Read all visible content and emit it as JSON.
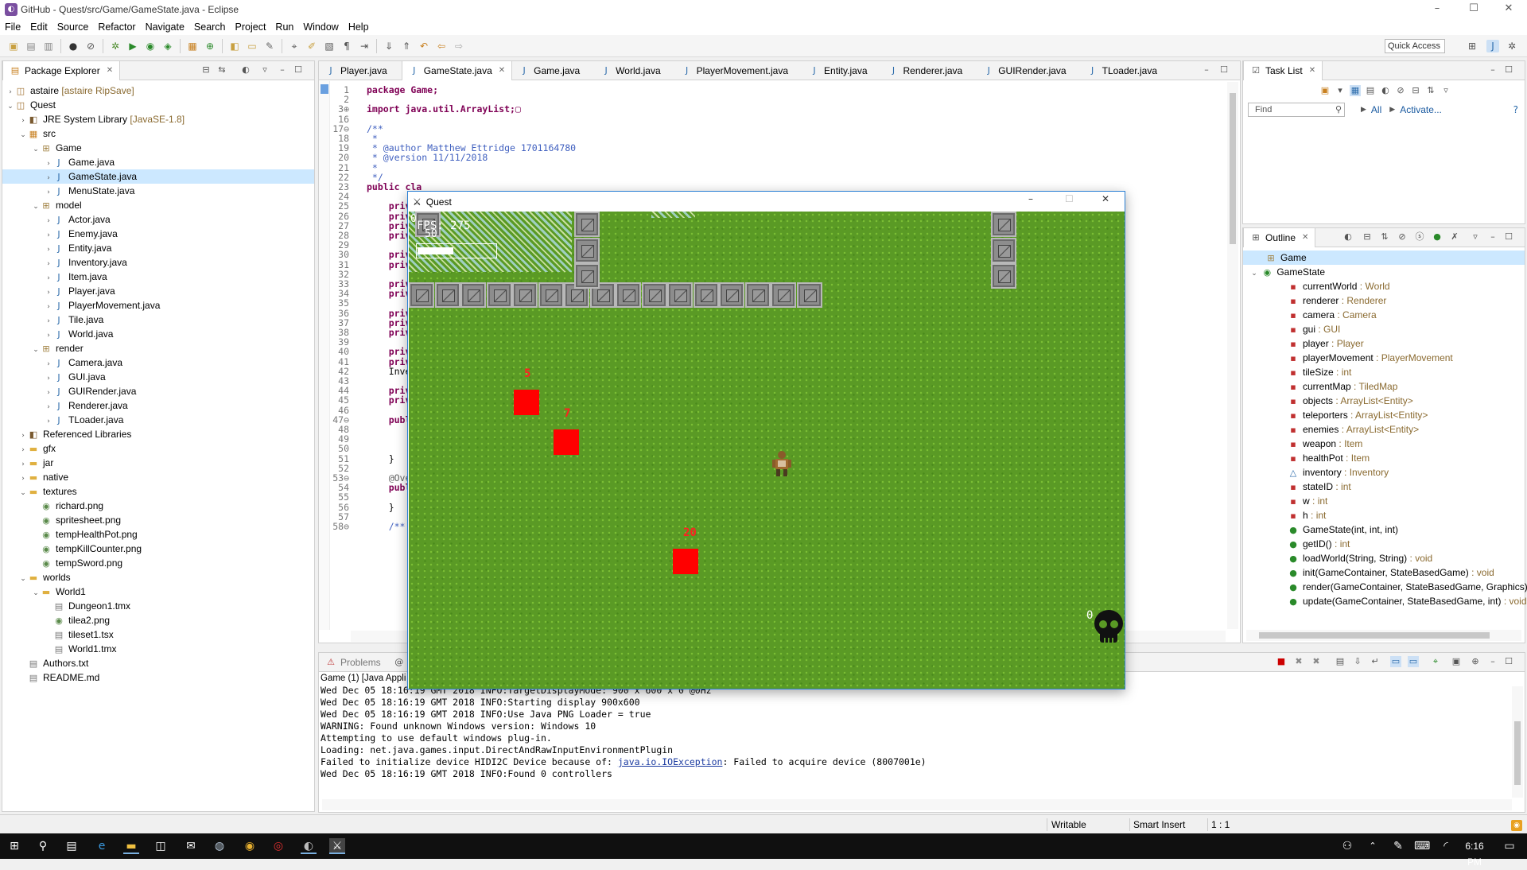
{
  "window": {
    "title": "GitHub - Quest/src/Game/GameState.java - Eclipse",
    "minimize": "–",
    "maximize": "☐",
    "close": "✕"
  },
  "menu": [
    "File",
    "Edit",
    "Source",
    "Refactor",
    "Navigate",
    "Search",
    "Project",
    "Run",
    "Window",
    "Help"
  ],
  "toolbar": {
    "quick_access": "Quick Access"
  },
  "package_explorer": {
    "tab_label": "Package Explorer",
    "tree": [
      {
        "level": 0,
        "arrow": "›",
        "icon": "project",
        "label": "astaire",
        "extra": " [astaire RipSave]"
      },
      {
        "level": 0,
        "arrow": "⌄",
        "icon": "project",
        "label": "Quest",
        "extra": ""
      },
      {
        "level": 1,
        "arrow": "›",
        "icon": "library",
        "label": "JRE System Library",
        "extra": " [JavaSE-1.8]"
      },
      {
        "level": 1,
        "arrow": "⌄",
        "icon": "srcfolder",
        "label": "src",
        "extra": ""
      },
      {
        "level": 2,
        "arrow": "⌄",
        "icon": "package",
        "label": "Game",
        "extra": ""
      },
      {
        "level": 3,
        "arrow": "›",
        "icon": "java",
        "label": "Game.java",
        "extra": ""
      },
      {
        "level": 3,
        "arrow": "›",
        "icon": "java",
        "label": "GameState.java",
        "extra": "",
        "selected": true
      },
      {
        "level": 3,
        "arrow": "›",
        "icon": "java",
        "label": "MenuState.java",
        "extra": ""
      },
      {
        "level": 2,
        "arrow": "⌄",
        "icon": "package",
        "label": "model",
        "extra": ""
      },
      {
        "level": 3,
        "arrow": "›",
        "icon": "java",
        "label": "Actor.java",
        "extra": ""
      },
      {
        "level": 3,
        "arrow": "›",
        "icon": "java",
        "label": "Enemy.java",
        "extra": ""
      },
      {
        "level": 3,
        "arrow": "›",
        "icon": "java",
        "label": "Entity.java",
        "extra": ""
      },
      {
        "level": 3,
        "arrow": "›",
        "icon": "java",
        "label": "Inventory.java",
        "extra": ""
      },
      {
        "level": 3,
        "arrow": "›",
        "icon": "java",
        "label": "Item.java",
        "extra": ""
      },
      {
        "level": 3,
        "arrow": "›",
        "icon": "java",
        "label": "Player.java",
        "extra": ""
      },
      {
        "level": 3,
        "arrow": "›",
        "icon": "java",
        "label": "PlayerMovement.java",
        "extra": ""
      },
      {
        "level": 3,
        "arrow": "›",
        "icon": "java",
        "label": "Tile.java",
        "extra": ""
      },
      {
        "level": 3,
        "arrow": "›",
        "icon": "java",
        "label": "World.java",
        "extra": ""
      },
      {
        "level": 2,
        "arrow": "⌄",
        "icon": "package",
        "label": "render",
        "extra": ""
      },
      {
        "level": 3,
        "arrow": "›",
        "icon": "java",
        "label": "Camera.java",
        "extra": ""
      },
      {
        "level": 3,
        "arrow": "›",
        "icon": "java",
        "label": "GUI.java",
        "extra": ""
      },
      {
        "level": 3,
        "arrow": "›",
        "icon": "java",
        "label": "GUIRender.java",
        "extra": ""
      },
      {
        "level": 3,
        "arrow": "›",
        "icon": "java",
        "label": "Renderer.java",
        "extra": ""
      },
      {
        "level": 3,
        "arrow": "›",
        "icon": "java",
        "label": "TLoader.java",
        "extra": ""
      },
      {
        "level": 1,
        "arrow": "›",
        "icon": "library",
        "label": "Referenced Libraries",
        "extra": ""
      },
      {
        "level": 1,
        "arrow": "›",
        "icon": "folder",
        "label": "gfx",
        "extra": ""
      },
      {
        "level": 1,
        "arrow": "›",
        "icon": "folder",
        "label": "jar",
        "extra": ""
      },
      {
        "level": 1,
        "arrow": "›",
        "icon": "folder",
        "label": "native",
        "extra": ""
      },
      {
        "level": 1,
        "arrow": "⌄",
        "icon": "folder",
        "label": "textures",
        "extra": ""
      },
      {
        "level": 2,
        "arrow": "",
        "icon": "image",
        "label": "richard.png",
        "extra": ""
      },
      {
        "level": 2,
        "arrow": "",
        "icon": "image",
        "label": "spritesheet.png",
        "extra": ""
      },
      {
        "level": 2,
        "arrow": "",
        "icon": "image",
        "label": "tempHealthPot.png",
        "extra": ""
      },
      {
        "level": 2,
        "arrow": "",
        "icon": "image",
        "label": "tempKillCounter.png",
        "extra": ""
      },
      {
        "level": 2,
        "arrow": "",
        "icon": "image",
        "label": "tempSword.png",
        "extra": ""
      },
      {
        "level": 1,
        "arrow": "⌄",
        "icon": "folder",
        "label": "worlds",
        "extra": ""
      },
      {
        "level": 2,
        "arrow": "⌄",
        "icon": "folder",
        "label": "World1",
        "extra": ""
      },
      {
        "level": 3,
        "arrow": "",
        "icon": "file",
        "label": "Dungeon1.tmx",
        "extra": ""
      },
      {
        "level": 3,
        "arrow": "",
        "icon": "image",
        "label": "tilea2.png",
        "extra": ""
      },
      {
        "level": 3,
        "arrow": "",
        "icon": "file",
        "label": "tileset1.tsx",
        "extra": ""
      },
      {
        "level": 3,
        "arrow": "",
        "icon": "file",
        "label": "World1.tmx",
        "extra": ""
      },
      {
        "level": 1,
        "arrow": "",
        "icon": "file",
        "label": "Authors.txt",
        "extra": ""
      },
      {
        "level": 1,
        "arrow": "",
        "icon": "file",
        "label": "README.md",
        "extra": ""
      }
    ]
  },
  "editor": {
    "tabs": [
      "Player.java",
      "GameState.java",
      "Game.java",
      "World.java",
      "PlayerMovement.java",
      "Entity.java",
      "Renderer.java",
      "GUIRender.java",
      "TLoader.java"
    ],
    "active_tab": 1,
    "lines": [
      {
        "n": "1",
        "t": "package Game;",
        "c": "kwline"
      },
      {
        "n": "2",
        "t": "",
        "c": ""
      },
      {
        "n": "3⊕",
        "t": "import java.util.ArrayList;▢",
        "c": "kwline"
      },
      {
        "n": "16",
        "t": "",
        "c": ""
      },
      {
        "n": "17⊖",
        "t": "/**",
        "c": "jd"
      },
      {
        "n": "18",
        "t": " *",
        "c": "jd"
      },
      {
        "n": "19",
        "t": " * @author Matthew Ettridge 1701164780",
        "c": "jd"
      },
      {
        "n": "20",
        "t": " * @version 11/11/2018",
        "c": "jd"
      },
      {
        "n": "21",
        "t": " *",
        "c": "jd"
      },
      {
        "n": "22",
        "t": " */",
        "c": "jd"
      },
      {
        "n": "23",
        "t": "public cla",
        "c": "kwline"
      },
      {
        "n": "24",
        "t": "",
        "c": ""
      },
      {
        "n": "25",
        "t": "    priva",
        "c": "kwline"
      },
      {
        "n": "26",
        "t": "    priva",
        "c": "kwline"
      },
      {
        "n": "27",
        "t": "    priva",
        "c": "kwline"
      },
      {
        "n": "28",
        "t": "    priva",
        "c": "kwline"
      },
      {
        "n": "29",
        "t": "",
        "c": ""
      },
      {
        "n": "30",
        "t": "    priva",
        "c": "kwline"
      },
      {
        "n": "31",
        "t": "    priva",
        "c": "kwline"
      },
      {
        "n": "32",
        "t": "",
        "c": ""
      },
      {
        "n": "33",
        "t": "    priva",
        "c": "kwline"
      },
      {
        "n": "34",
        "t": "    priva",
        "c": "kwline"
      },
      {
        "n": "35",
        "t": "",
        "c": ""
      },
      {
        "n": "36",
        "t": "    priva",
        "c": "kwline"
      },
      {
        "n": "37",
        "t": "    priva",
        "c": "kwline"
      },
      {
        "n": "38",
        "t": "    priva",
        "c": "kwline"
      },
      {
        "n": "39",
        "t": "",
        "c": ""
      },
      {
        "n": "40",
        "t": "    priva",
        "c": "kwline"
      },
      {
        "n": "41",
        "t": "    priva",
        "c": "kwline"
      },
      {
        "n": "42",
        "t": "    Invent",
        "c": ""
      },
      {
        "n": "43",
        "t": "",
        "c": ""
      },
      {
        "n": "44",
        "t": "    priva",
        "c": "kwline"
      },
      {
        "n": "45",
        "t": "    priva",
        "c": "kwline"
      },
      {
        "n": "46",
        "t": "",
        "c": ""
      },
      {
        "n": "47⊖",
        "t": "    publi",
        "c": "kwline"
      },
      {
        "n": "48",
        "t": "        th",
        "c": "kwline"
      },
      {
        "n": "49",
        "t": "        th",
        "c": "kwline"
      },
      {
        "n": "50",
        "t": "        th",
        "c": "kwline"
      },
      {
        "n": "51",
        "t": "    }",
        "c": ""
      },
      {
        "n": "52",
        "t": "",
        "c": ""
      },
      {
        "n": "53⊖",
        "t": "    @Overr",
        "c": "ann"
      },
      {
        "n": "54",
        "t": "    publi",
        "c": "kwline"
      },
      {
        "n": "55",
        "t": "        re",
        "c": "kwline"
      },
      {
        "n": "56",
        "t": "    }",
        "c": ""
      },
      {
        "n": "57",
        "t": "",
        "c": ""
      },
      {
        "n": "58⊖",
        "t": "    /**",
        "c": "jd"
      }
    ]
  },
  "task_list": {
    "tab_label": "Task List",
    "find_placeholder": "Find",
    "all_label": "All",
    "activate_label": "Activate..."
  },
  "outline": {
    "tab_label": "Outline",
    "package": "Game",
    "class": "GameState",
    "members": [
      {
        "name": "currentWorld",
        "type": "World",
        "kind": "field"
      },
      {
        "name": "renderer",
        "type": "Renderer",
        "kind": "field"
      },
      {
        "name": "camera",
        "type": "Camera",
        "kind": "field"
      },
      {
        "name": "gui",
        "type": "GUI",
        "kind": "field"
      },
      {
        "name": "player",
        "type": "Player",
        "kind": "field"
      },
      {
        "name": "playerMovement",
        "type": "PlayerMovement",
        "kind": "field"
      },
      {
        "name": "tileSize",
        "type": "int",
        "kind": "field"
      },
      {
        "name": "currentMap",
        "type": "TiledMap",
        "kind": "field"
      },
      {
        "name": "objects",
        "type": "ArrayList<Entity>",
        "kind": "field"
      },
      {
        "name": "teleporters",
        "type": "ArrayList<Entity>",
        "kind": "field"
      },
      {
        "name": "enemies",
        "type": "ArrayList<Entity>",
        "kind": "field"
      },
      {
        "name": "weapon",
        "type": "Item",
        "kind": "field"
      },
      {
        "name": "healthPot",
        "type": "Item",
        "kind": "field"
      },
      {
        "name": "inventory",
        "type": "Inventory",
        "kind": "pkgfield"
      },
      {
        "name": "stateID",
        "type": "int",
        "kind": "field"
      },
      {
        "name": "w",
        "type": "int",
        "kind": "field"
      },
      {
        "name": "h",
        "type": "int",
        "kind": "field"
      },
      {
        "name": "GameState(int, int, int)",
        "type": "",
        "kind": "ctor"
      },
      {
        "name": "getID()",
        "type": "int",
        "kind": "method"
      },
      {
        "name": "loadWorld(String, String)",
        "type": "void",
        "kind": "method"
      },
      {
        "name": "init(GameContainer, StateBasedGame)",
        "type": "void",
        "kind": "method"
      },
      {
        "name": "render(GameContainer, StateBasedGame, Graphics)",
        "type": "void",
        "kind": "method"
      },
      {
        "name": "update(GameContainer, StateBasedGame, int)",
        "type": "void",
        "kind": "method"
      }
    ]
  },
  "console": {
    "tab_problems": "Problems",
    "tab_partial": "Ja",
    "header": "Game (1) [Java Appli",
    "lines": [
      "Wed Dec 05 18:16:19 GMT 2018 INFO:TargetDisplayMode: 900 x 600 x 0 @0Hz",
      "Wed Dec 05 18:16:19 GMT 2018 INFO:Starting display 900x600",
      "Wed Dec 05 18:16:19 GMT 2018 INFO:Use Java PNG Loader = true",
      "WARNING: Found unknown Windows version: Windows 10",
      "Attempting to use default windows plug-in.",
      "Loading: net.java.games.input.DirectAndRawInputEnvironmentPlugin"
    ],
    "error_prefix": "Failed to initialize device HIDI2C Device because of: ",
    "error_link": "java.io.IOException",
    "error_suffix": ": Failed to acquire device (8007001e)",
    "last_line": "Wed Dec 05 18:16:19 GMT 2018 INFO:Found 0 controllers"
  },
  "status": {
    "writable": "Writable",
    "insert": "Smart Insert",
    "position": "1 : 1"
  },
  "game": {
    "title": "Quest",
    "fps": "FPS: 275",
    "health": "50",
    "health_fraction": 0.45,
    "corner_zero": "0",
    "kill_count": "0",
    "enemies": [
      {
        "label": "5"
      },
      {
        "label": "7"
      },
      {
        "label": "20"
      }
    ]
  },
  "taskbar": {
    "time": "6:16 PM"
  },
  "colors": {
    "accent": "#2a7fd4",
    "keyword": "#7f0055",
    "javadoc": "#3f5fbf",
    "enemy": "#ff0000",
    "grass": "#5a9a25"
  }
}
